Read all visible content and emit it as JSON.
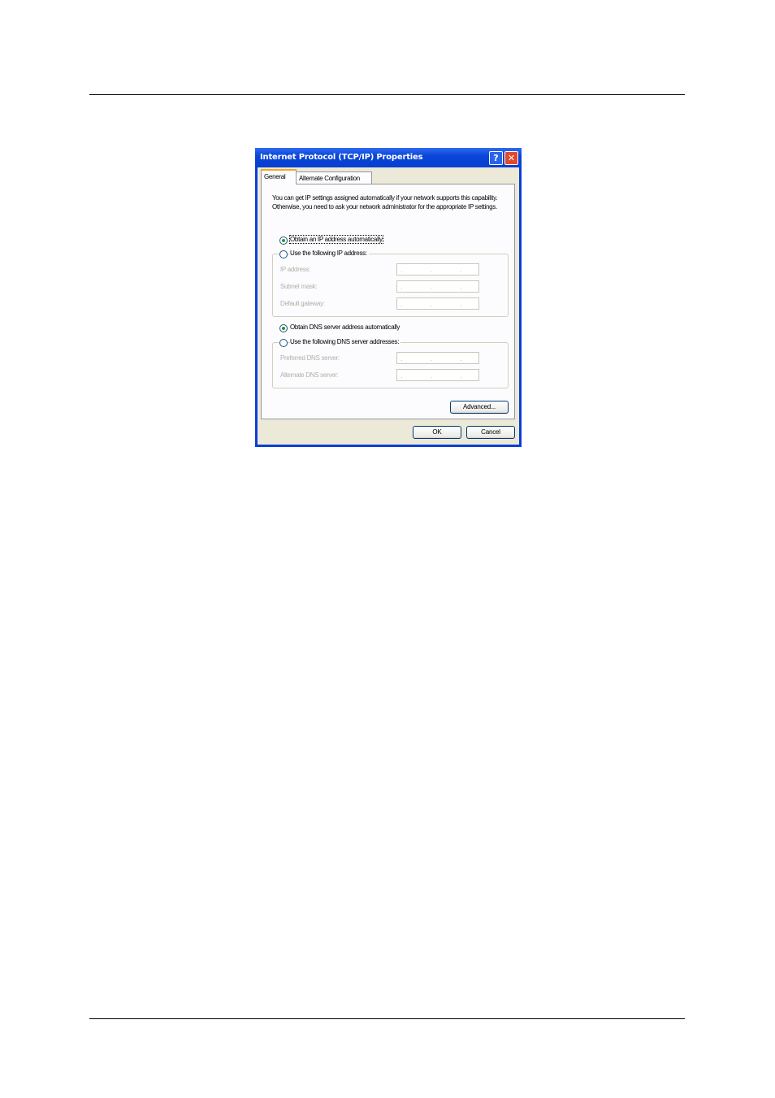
{
  "dialog": {
    "title": "Internet Protocol (TCP/IP) Properties",
    "help_label": "?",
    "close_label": "✕",
    "tabs": [
      {
        "label": "General"
      },
      {
        "label": "Alternate Configuration"
      }
    ],
    "description": "You can get IP settings assigned automatically if your network supports this capability. Otherwise, you need to ask your network administrator for the appropriate IP settings.",
    "ip": {
      "auto_label": "Obtain an IP address automatically",
      "manual_label": "Use the following IP address:",
      "selected": "auto",
      "fields": [
        {
          "label": "IP address:",
          "value": ". . ."
        },
        {
          "label": "Subnet mask:",
          "value": ". . ."
        },
        {
          "label": "Default gateway:",
          "value": ". . ."
        }
      ]
    },
    "dns": {
      "auto_label": "Obtain DNS server address automatically",
      "manual_label": "Use the following DNS server addresses:",
      "selected": "auto",
      "fields": [
        {
          "label": "Preferred DNS server:",
          "value": ". . ."
        },
        {
          "label": "Alternate DNS server:",
          "value": ". . ."
        }
      ]
    },
    "advanced_label": "Advanced...",
    "ok_label": "OK",
    "cancel_label": "Cancel"
  }
}
